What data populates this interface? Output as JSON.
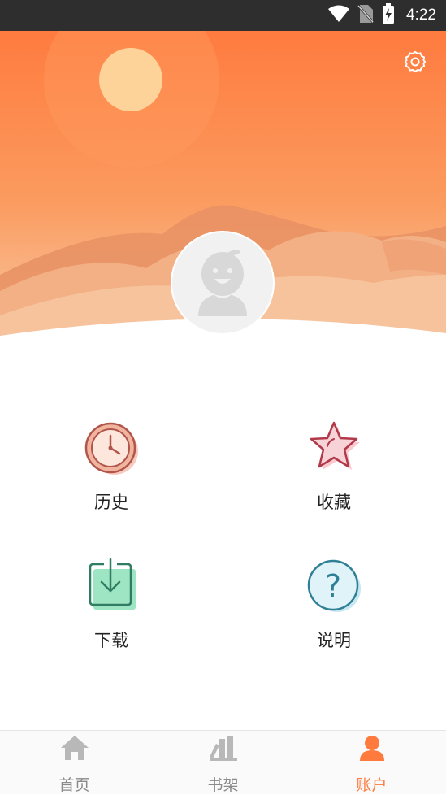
{
  "status_bar": {
    "time": "4:22",
    "icons": [
      "wifi-icon",
      "no-sim-icon",
      "battery-charging-icon"
    ]
  },
  "header": {
    "settings_icon": "gear-icon",
    "avatar_icon": "default-avatar-icon"
  },
  "menu": {
    "items": [
      {
        "label": "历史",
        "icon": "clock-icon"
      },
      {
        "label": "收藏",
        "icon": "star-icon"
      },
      {
        "label": "下载",
        "icon": "download-icon"
      },
      {
        "label": "说明",
        "icon": "help-icon"
      }
    ]
  },
  "bottom_nav": {
    "items": [
      {
        "label": "首页",
        "icon": "home-icon"
      },
      {
        "label": "书架",
        "icon": "bookshelf-icon"
      },
      {
        "label": "账户",
        "icon": "user-icon"
      }
    ],
    "active_index": 2
  },
  "colors": {
    "accent": "#ff7a3d",
    "status_bar": "#2e2e2e",
    "nav_inactive": "#8a8a8a",
    "hero_top": "#ff7b3f",
    "hero_bottom": "#f5c8a0"
  }
}
